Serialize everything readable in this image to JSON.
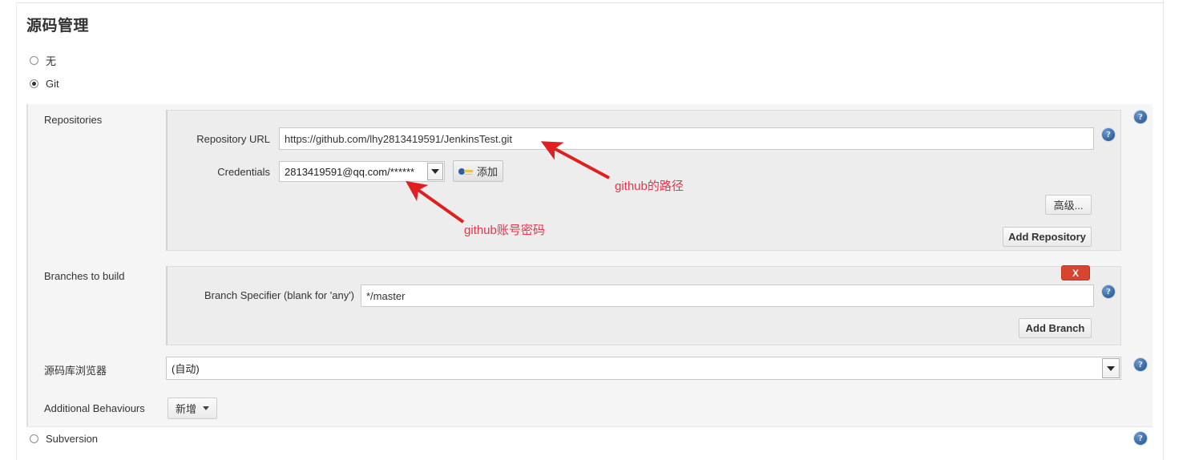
{
  "page": {
    "section_title": "源码管理"
  },
  "scm_options": [
    {
      "label": "无",
      "selected": false
    },
    {
      "label": "Git",
      "selected": true
    },
    {
      "label": "Subversion",
      "selected": false
    }
  ],
  "git": {
    "repositories": {
      "label": "Repositories",
      "repository_url": {
        "label": "Repository URL",
        "value": "https://github.com/lhy2813419591/JenkinsTest.git"
      },
      "credentials": {
        "label": "Credentials",
        "value": "2813419591@qq.com/******",
        "add_button": "添加"
      },
      "advanced_button": "高级...",
      "add_repository_button": "Add Repository"
    },
    "branches": {
      "label": "Branches to build",
      "branch_specifier": {
        "label": "Branch Specifier (blank for 'any')",
        "value": "*/master"
      },
      "delete_button": "X",
      "add_branch_button": "Add Branch"
    },
    "repository_browser": {
      "label": "源码库浏览器",
      "value": "(自动)"
    },
    "additional_behaviours": {
      "label": "Additional Behaviours",
      "add_button": "新增"
    }
  },
  "help": {
    "glyph": "?"
  },
  "annotations": [
    {
      "text": "github的路径"
    },
    {
      "text": "github账号密码"
    }
  ],
  "colors": {
    "annotation": "#e8344a",
    "delete_button": "#d9442f",
    "help_icon": "#3b6ea8"
  }
}
